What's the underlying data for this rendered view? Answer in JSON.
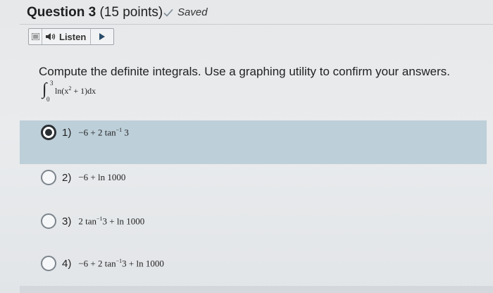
{
  "question": {
    "title": "Question 3",
    "points": "(15 points)",
    "status": "Saved"
  },
  "toolbar": {
    "menu_icon": "menu-icon",
    "speaker_icon": "speaker-icon",
    "listen_label": "Listen",
    "play_icon": "play-icon"
  },
  "prompt": "Compute the definite integrals. Use a graphing utility to confirm your answers.",
  "integral": {
    "upper": "3",
    "lower": "0",
    "integrand_prefix": "ln(x",
    "exponent": "2",
    "integrand_suffix": " + 1)dx"
  },
  "options": [
    {
      "number": "1)",
      "expr_a": "−6 + 2 tan",
      "sup": "−1",
      "expr_b": "3",
      "selected": true
    },
    {
      "number": "2)",
      "expr_a": "−6 + ln 1000",
      "sup": "",
      "expr_b": "",
      "selected": false
    },
    {
      "number": "3)",
      "expr_a": "2 tan",
      "sup": "−1",
      "expr_b": "3 + ln 1000",
      "selected": false
    },
    {
      "number": "4)",
      "expr_a": "−6 + 2 tan",
      "sup": "−1",
      "expr_b": "3 + ln 1000",
      "selected": false
    }
  ],
  "colors": {
    "selected_row": "#bdcfd9",
    "background": "#e6e8ea"
  }
}
